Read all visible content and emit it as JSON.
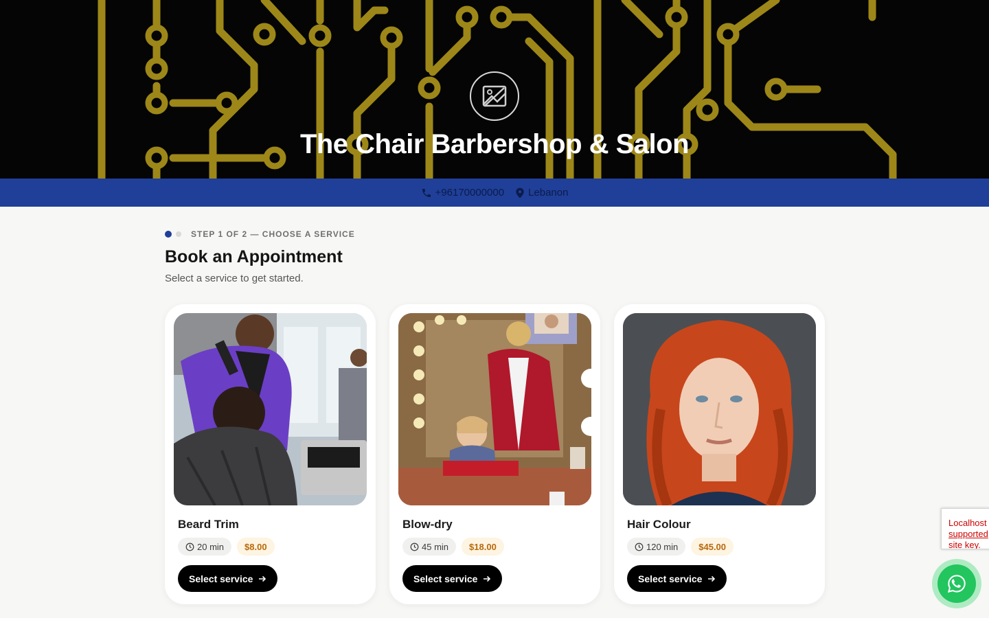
{
  "hero": {
    "title": "The Chair Barbershop & Salon",
    "logo_icon": "image-placeholder-icon"
  },
  "info_bar": {
    "phone": "+96170000000",
    "location": "Lebanon",
    "phone_icon": "phone-icon",
    "location_icon": "map-pin-icon"
  },
  "booking": {
    "step_label": "STEP 1 OF 2 — CHOOSE A SERVICE",
    "title": "Book an Appointment",
    "subtitle": "Select a service to get started."
  },
  "services": [
    {
      "name": "Beard Trim",
      "duration": "20 min",
      "price": "$8.00",
      "button": "Select service"
    },
    {
      "name": "Blow-dry",
      "duration": "45 min",
      "price": "$18.00",
      "button": "Select service"
    },
    {
      "name": "Hair Colour",
      "duration": "120 min",
      "price": "$45.00",
      "button": "Select service"
    }
  ],
  "recaptcha": {
    "line1": "Localhost",
    "line2": "supported",
    "line3": "site key."
  },
  "colors": {
    "accent": "#203f98",
    "price": "#b8690c",
    "whatsapp": "#22c55e",
    "circuit": "#b39a1c"
  }
}
